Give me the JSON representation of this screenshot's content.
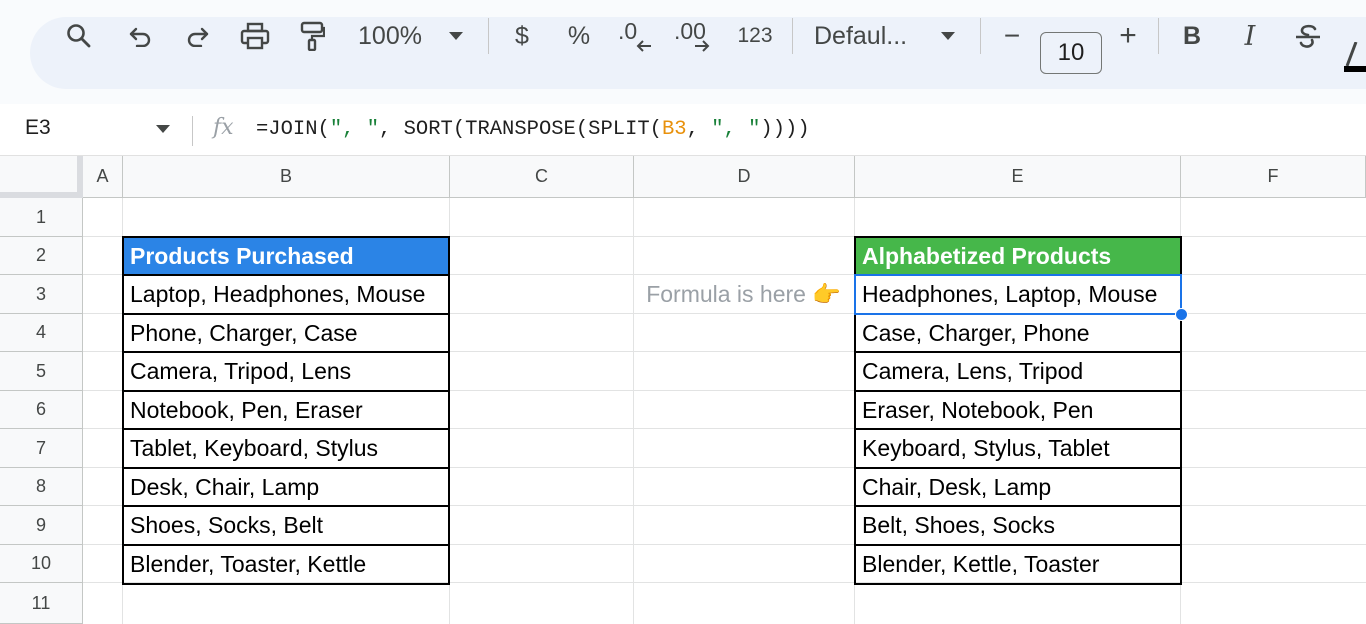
{
  "toolbar": {
    "zoom": "100%",
    "currency": "$",
    "percent": "%",
    "decrease_decimal": ".0",
    "increase_decimal": ".00",
    "number_format": "123",
    "font_name": "Defaul...",
    "font_size": "10",
    "minus": "−",
    "plus": "+",
    "bold": "B",
    "italic": "I"
  },
  "formula_bar": {
    "name_box": "E3",
    "fx": "fx",
    "formula_parts": [
      "=JOIN(",
      "\", \"",
      ", SORT(TRANSPOSE(SPLIT(",
      "B3",
      ", ",
      "\", \"",
      "))))"
    ]
  },
  "columns": [
    "A",
    "B",
    "C",
    "D",
    "E",
    "F"
  ],
  "rows": [
    "1",
    "2",
    "3",
    "4",
    "5",
    "6",
    "7",
    "8",
    "9",
    "10",
    "11"
  ],
  "table_left": {
    "header": "Products Purchased",
    "cells": [
      "Laptop, Headphones, Mouse",
      "Phone, Charger, Case",
      "Camera, Tripod, Lens",
      "Notebook, Pen, Eraser",
      "Tablet, Keyboard, Stylus",
      "Desk, Chair, Lamp",
      "Shoes, Socks, Belt",
      "Blender, Toaster, Kettle"
    ]
  },
  "table_right": {
    "header": "Alphabetized Products",
    "cells": [
      "Headphones, Laptop, Mouse",
      "Case, Charger, Phone",
      "Camera, Lens, Tripod",
      "Eraser, Notebook, Pen",
      "Keyboard, Stylus, Tablet",
      "Chair, Desk, Lamp",
      "Belt, Shoes, Socks",
      "Blender, Kettle, Toaster"
    ]
  },
  "note": "Formula is here 👉",
  "colors": {
    "header_blue": "#2b84e6",
    "header_green": "#46b74a",
    "selection": "#1a73e8",
    "formula_string": "#188038",
    "formula_reference": "#e8910c"
  }
}
